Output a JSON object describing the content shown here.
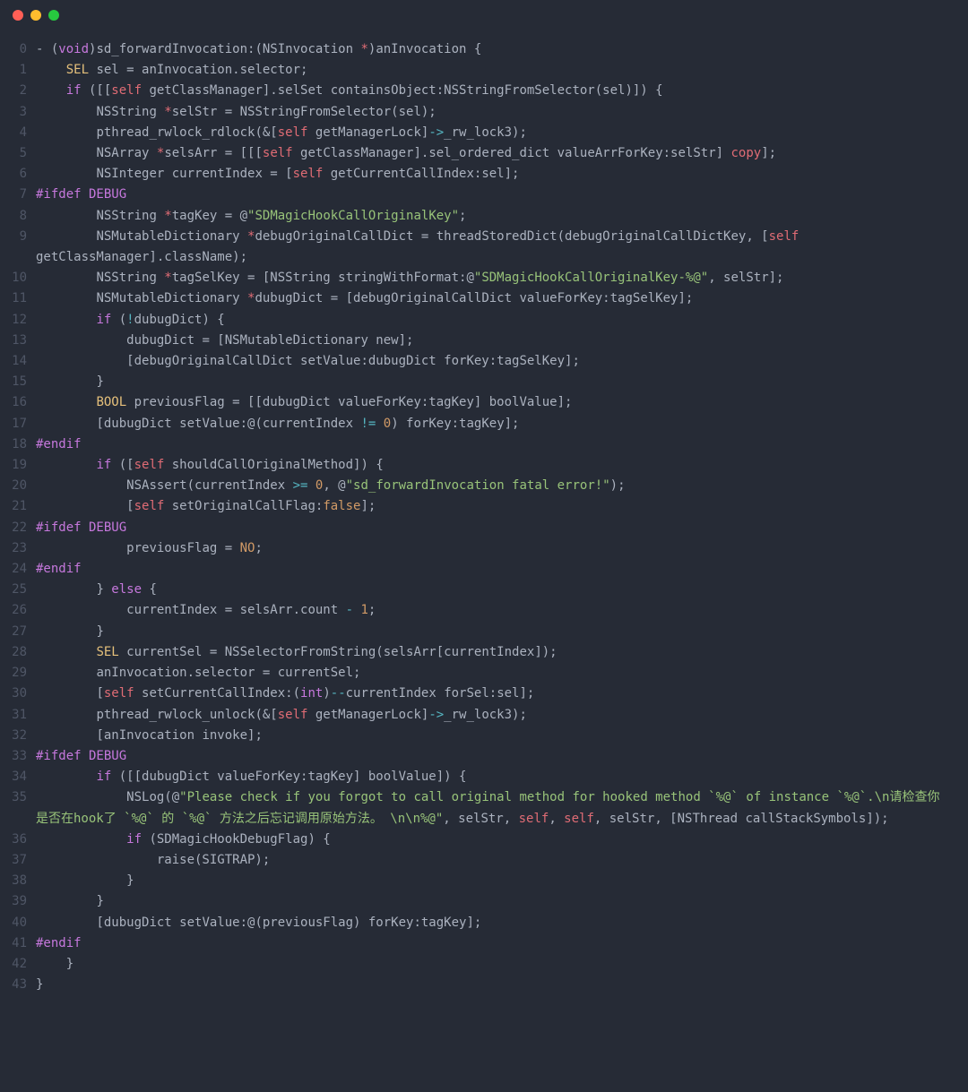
{
  "window": {
    "title": "code"
  },
  "colors": {
    "bg": "#262b36",
    "gutter": "#4f5666",
    "default": "#abb2bf",
    "keyword": "#c678dd",
    "type": "#e5c07b",
    "self": "#e06c75",
    "num": "#d19a66",
    "string": "#98c379",
    "func": "#61afef",
    "op": "#56b6c2"
  },
  "lines": [
    {
      "n": "0",
      "t": [
        [
          "default",
          "- ("
        ],
        [
          "keyword",
          "void"
        ],
        [
          "default",
          ")sd_forwardInvocation:(NSInvocation "
        ],
        [
          "self",
          "*"
        ],
        [
          "default",
          ")anInvocation {"
        ]
      ]
    },
    {
      "n": "1",
      "t": [
        [
          "default",
          "    "
        ],
        [
          "type",
          "SEL"
        ],
        [
          "default",
          " sel = anInvocation.selector;"
        ]
      ]
    },
    {
      "n": "2",
      "t": [
        [
          "default",
          "    "
        ],
        [
          "keyword",
          "if"
        ],
        [
          "default",
          " ([["
        ],
        [
          "self",
          "self"
        ],
        [
          "default",
          " getClassManager].selSet containsObject:NSStringFromSelector(sel)]) {"
        ]
      ]
    },
    {
      "n": "3",
      "t": [
        [
          "default",
          "        NSString "
        ],
        [
          "self",
          "*"
        ],
        [
          "default",
          "selStr = NSStringFromSelector(sel);"
        ]
      ]
    },
    {
      "n": "4",
      "t": [
        [
          "default",
          "        pthread_rwlock_rdlock(&["
        ],
        [
          "self",
          "self"
        ],
        [
          "default",
          " getManagerLock]"
        ],
        [
          "op",
          "->"
        ],
        [
          "default",
          "_rw_lock3);"
        ]
      ]
    },
    {
      "n": "5",
      "t": [
        [
          "default",
          "        NSArray "
        ],
        [
          "self",
          "*"
        ],
        [
          "default",
          "selsArr = [[["
        ],
        [
          "self",
          "self"
        ],
        [
          "default",
          " getClassManager].sel_ordered_dict valueArrForKey:selStr] "
        ],
        [
          "self",
          "copy"
        ],
        [
          "default",
          "];"
        ]
      ]
    },
    {
      "n": "6",
      "t": [
        [
          "default",
          "        NSInteger currentIndex = ["
        ],
        [
          "self",
          "self"
        ],
        [
          "default",
          " getCurrentCallIndex:sel];"
        ]
      ]
    },
    {
      "n": "7",
      "t": [
        [
          "keyword",
          "#ifdef DEBUG"
        ]
      ]
    },
    {
      "n": "8",
      "t": [
        [
          "default",
          "        NSString "
        ],
        [
          "self",
          "*"
        ],
        [
          "default",
          "tagKey = @"
        ],
        [
          "string",
          "\"SDMagicHookCallOriginalKey\""
        ],
        [
          "default",
          ";"
        ]
      ]
    },
    {
      "n": "9",
      "t": [
        [
          "default",
          "        NSMutableDictionary "
        ],
        [
          "self",
          "*"
        ],
        [
          "default",
          "debugOriginalCallDict = threadStoredDict(debugOriginalCallDictKey, ["
        ],
        [
          "self",
          "self"
        ],
        [
          "default",
          " getClassManager].className);"
        ]
      ]
    },
    {
      "n": "10",
      "t": [
        [
          "default",
          "        NSString "
        ],
        [
          "self",
          "*"
        ],
        [
          "default",
          "tagSelKey = [NSString stringWithFormat:@"
        ],
        [
          "string",
          "\"SDMagicHookCallOriginalKey-%@\""
        ],
        [
          "default",
          ", selStr];"
        ]
      ]
    },
    {
      "n": "11",
      "t": [
        [
          "default",
          "        NSMutableDictionary "
        ],
        [
          "self",
          "*"
        ],
        [
          "default",
          "dubugDict = [debugOriginalCallDict valueForKey:tagSelKey];"
        ]
      ]
    },
    {
      "n": "12",
      "t": [
        [
          "default",
          "        "
        ],
        [
          "keyword",
          "if"
        ],
        [
          "default",
          " ("
        ],
        [
          "op",
          "!"
        ],
        [
          "default",
          "dubugDict) {"
        ]
      ]
    },
    {
      "n": "13",
      "t": [
        [
          "default",
          "            dubugDict = [NSMutableDictionary new];"
        ]
      ]
    },
    {
      "n": "14",
      "t": [
        [
          "default",
          "            [debugOriginalCallDict setValue:dubugDict forKey:tagSelKey];"
        ]
      ]
    },
    {
      "n": "15",
      "t": [
        [
          "default",
          "        }"
        ]
      ]
    },
    {
      "n": "16",
      "t": [
        [
          "default",
          "        "
        ],
        [
          "type",
          "BOOL"
        ],
        [
          "default",
          " previousFlag = [[dubugDict valueForKey:tagKey] boolValue];"
        ]
      ]
    },
    {
      "n": "17",
      "t": [
        [
          "default",
          "        [dubugDict setValue:@(currentIndex "
        ],
        [
          "op",
          "!="
        ],
        [
          "default",
          " "
        ],
        [
          "num",
          "0"
        ],
        [
          "default",
          ") forKey:tagKey];"
        ]
      ]
    },
    {
      "n": "18",
      "t": [
        [
          "keyword",
          "#endif"
        ]
      ]
    },
    {
      "n": "19",
      "t": [
        [
          "default",
          "        "
        ],
        [
          "keyword",
          "if"
        ],
        [
          "default",
          " (["
        ],
        [
          "self",
          "self"
        ],
        [
          "default",
          " shouldCallOriginalMethod]) {"
        ]
      ]
    },
    {
      "n": "20",
      "t": [
        [
          "default",
          "            NSAssert(currentIndex "
        ],
        [
          "op",
          ">="
        ],
        [
          "default",
          " "
        ],
        [
          "num",
          "0"
        ],
        [
          "default",
          ", @"
        ],
        [
          "string",
          "\"sd_forwardInvocation fatal error!\""
        ],
        [
          "default",
          ");"
        ]
      ]
    },
    {
      "n": "21",
      "t": [
        [
          "default",
          "            ["
        ],
        [
          "self",
          "self"
        ],
        [
          "default",
          " setOriginalCallFlag:"
        ],
        [
          "num",
          "false"
        ],
        [
          "default",
          "];"
        ]
      ]
    },
    {
      "n": "22",
      "t": [
        [
          "keyword",
          "#ifdef DEBUG"
        ]
      ]
    },
    {
      "n": "23",
      "t": [
        [
          "default",
          "            previousFlag = "
        ],
        [
          "num",
          "NO"
        ],
        [
          "default",
          ";"
        ]
      ]
    },
    {
      "n": "24",
      "t": [
        [
          "keyword",
          "#endif"
        ]
      ]
    },
    {
      "n": "25",
      "t": [
        [
          "default",
          "        } "
        ],
        [
          "keyword",
          "else"
        ],
        [
          "default",
          " {"
        ]
      ]
    },
    {
      "n": "26",
      "t": [
        [
          "default",
          "            currentIndex = selsArr.count "
        ],
        [
          "op",
          "-"
        ],
        [
          "default",
          " "
        ],
        [
          "num",
          "1"
        ],
        [
          "default",
          ";"
        ]
      ]
    },
    {
      "n": "27",
      "t": [
        [
          "default",
          "        }"
        ]
      ]
    },
    {
      "n": "28",
      "t": [
        [
          "default",
          "        "
        ],
        [
          "type",
          "SEL"
        ],
        [
          "default",
          " currentSel = NSSelectorFromString(selsArr[currentIndex]);"
        ]
      ]
    },
    {
      "n": "29",
      "t": [
        [
          "default",
          "        anInvocation.selector = currentSel;"
        ]
      ]
    },
    {
      "n": "30",
      "t": [
        [
          "default",
          "        ["
        ],
        [
          "self",
          "self"
        ],
        [
          "default",
          " setCurrentCallIndex:("
        ],
        [
          "keyword",
          "int"
        ],
        [
          "default",
          ")"
        ],
        [
          "op",
          "--"
        ],
        [
          "default",
          "currentIndex forSel:sel];"
        ]
      ]
    },
    {
      "n": "31",
      "t": [
        [
          "default",
          "        pthread_rwlock_unlock(&["
        ],
        [
          "self",
          "self"
        ],
        [
          "default",
          " getManagerLock]"
        ],
        [
          "op",
          "->"
        ],
        [
          "default",
          "_rw_lock3);"
        ]
      ]
    },
    {
      "n": "32",
      "t": [
        [
          "default",
          "        [anInvocation invoke];"
        ]
      ]
    },
    {
      "n": "33",
      "t": [
        [
          "keyword",
          "#ifdef DEBUG"
        ]
      ]
    },
    {
      "n": "34",
      "t": [
        [
          "default",
          "        "
        ],
        [
          "keyword",
          "if"
        ],
        [
          "default",
          " ([[dubugDict valueForKey:tagKey] boolValue]) {"
        ]
      ]
    },
    {
      "n": "35",
      "t": [
        [
          "default",
          "            NSLog(@"
        ],
        [
          "string",
          "\"Please check if you forgot to call original method for hooked method `%@` of instance `%@`.\\n请检查你是否在hook了 `%@` 的 `%@` 方法之后忘记调用原始方法。 \\n\\n%@\""
        ],
        [
          "default",
          ", selStr, "
        ],
        [
          "self",
          "self"
        ],
        [
          "default",
          ", "
        ],
        [
          "self",
          "self"
        ],
        [
          "default",
          ", selStr, [NSThread callStackSymbols]);"
        ]
      ]
    },
    {
      "n": "36",
      "t": [
        [
          "default",
          "            "
        ],
        [
          "keyword",
          "if"
        ],
        [
          "default",
          " (SDMagicHookDebugFlag) {"
        ]
      ]
    },
    {
      "n": "37",
      "t": [
        [
          "default",
          "                raise(SIGTRAP);"
        ]
      ]
    },
    {
      "n": "38",
      "t": [
        [
          "default",
          "            }"
        ]
      ]
    },
    {
      "n": "39",
      "t": [
        [
          "default",
          "        }"
        ]
      ]
    },
    {
      "n": "40",
      "t": [
        [
          "default",
          "        [dubugDict setValue:@(previousFlag) forKey:tagKey];"
        ]
      ]
    },
    {
      "n": "41",
      "t": [
        [
          "keyword",
          "#endif"
        ]
      ]
    },
    {
      "n": "42",
      "t": [
        [
          "default",
          "    }"
        ]
      ]
    },
    {
      "n": "43",
      "t": [
        [
          "default",
          "}"
        ]
      ]
    }
  ]
}
